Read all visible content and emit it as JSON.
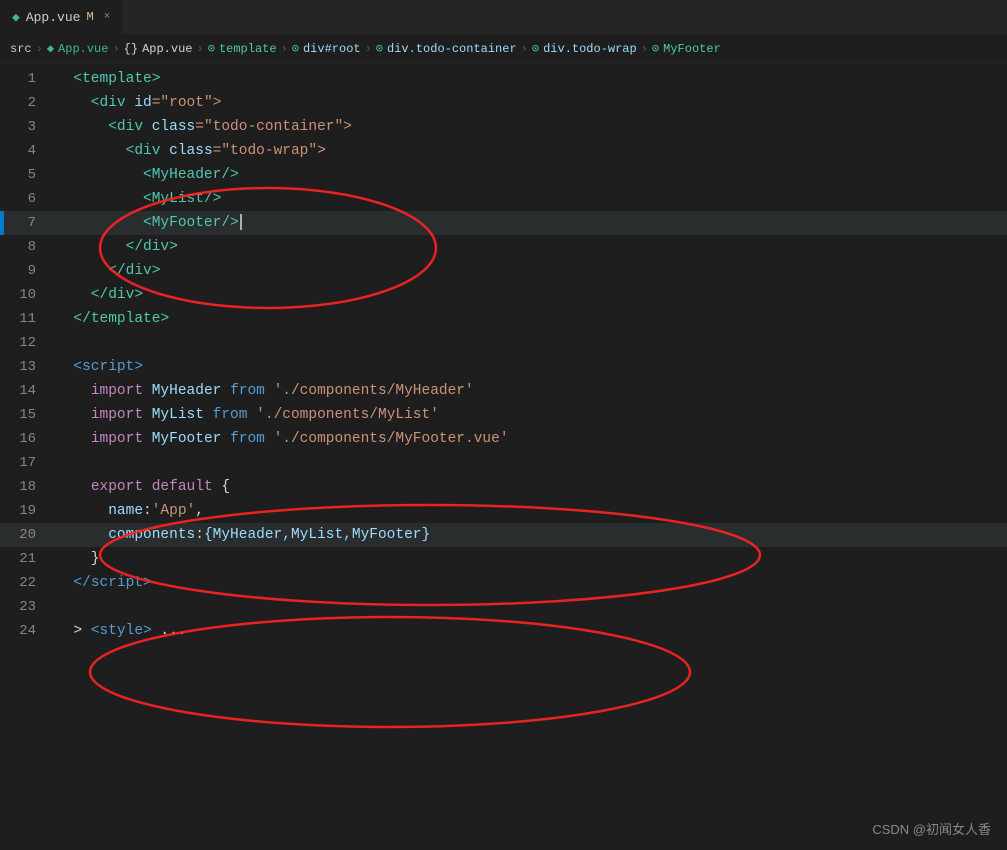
{
  "tab": {
    "filename": "App.vue",
    "modified": "M",
    "close_label": "×"
  },
  "breadcrumb": {
    "items": [
      "src",
      "App.vue",
      "App.vue",
      "template",
      "div#root",
      "div.todo-container",
      "div.todo-wrap",
      "MyFooter"
    ]
  },
  "lines": [
    {
      "num": 1,
      "tokens": [
        {
          "text": "  <",
          "cls": "c-tag"
        },
        {
          "text": "template",
          "cls": "c-tag"
        },
        {
          "text": ">",
          "cls": "c-tag"
        }
      ]
    },
    {
      "num": 2,
      "tokens": [
        {
          "text": "    <",
          "cls": "c-tag"
        },
        {
          "text": "div ",
          "cls": "c-tag"
        },
        {
          "text": "id",
          "cls": "c-attr-name"
        },
        {
          "text": "=\"root\">",
          "cls": "c-attr-val"
        }
      ]
    },
    {
      "num": 3,
      "tokens": [
        {
          "text": "      <",
          "cls": "c-tag"
        },
        {
          "text": "div ",
          "cls": "c-tag"
        },
        {
          "text": "class",
          "cls": "c-attr-name"
        },
        {
          "text": "=\"todo-container\">",
          "cls": "c-attr-val"
        }
      ]
    },
    {
      "num": 4,
      "tokens": [
        {
          "text": "        <",
          "cls": "c-tag"
        },
        {
          "text": "div ",
          "cls": "c-tag"
        },
        {
          "text": "class",
          "cls": "c-attr-name"
        },
        {
          "text": "=\"todo-wrap\">",
          "cls": "c-attr-val"
        }
      ]
    },
    {
      "num": 5,
      "tokens": [
        {
          "text": "          <",
          "cls": "c-component"
        },
        {
          "text": "MyHeader",
          "cls": "c-component"
        },
        {
          "text": "/>",
          "cls": "c-component"
        }
      ]
    },
    {
      "num": 6,
      "tokens": [
        {
          "text": "          <",
          "cls": "c-component"
        },
        {
          "text": "MyList",
          "cls": "c-component"
        },
        {
          "text": "/>",
          "cls": "c-component"
        }
      ]
    },
    {
      "num": 7,
      "tokens": [
        {
          "text": "          <",
          "cls": "c-component"
        },
        {
          "text": "MyFooter",
          "cls": "c-component"
        },
        {
          "text": "/>",
          "cls": "c-component"
        }
      ],
      "active": true
    },
    {
      "num": 8,
      "tokens": [
        {
          "text": "        </",
          "cls": "c-tag"
        },
        {
          "text": "div",
          "cls": "c-tag"
        },
        {
          "text": ">",
          "cls": "c-tag"
        }
      ]
    },
    {
      "num": 9,
      "tokens": [
        {
          "text": "      </",
          "cls": "c-tag"
        },
        {
          "text": "div",
          "cls": "c-tag"
        },
        {
          "text": ">",
          "cls": "c-tag"
        }
      ]
    },
    {
      "num": 10,
      "tokens": [
        {
          "text": "    </",
          "cls": "c-tag"
        },
        {
          "text": "div",
          "cls": "c-tag"
        },
        {
          "text": ">",
          "cls": "c-tag"
        }
      ]
    },
    {
      "num": 11,
      "tokens": [
        {
          "text": "  </",
          "cls": "c-tag"
        },
        {
          "text": "template",
          "cls": "c-tag"
        },
        {
          "text": ">",
          "cls": "c-tag"
        }
      ]
    },
    {
      "num": 12,
      "tokens": []
    },
    {
      "num": 13,
      "tokens": [
        {
          "text": "  <",
          "cls": "c-script"
        },
        {
          "text": "script",
          "cls": "c-script"
        },
        {
          "text": ">",
          "cls": "c-script"
        }
      ]
    },
    {
      "num": 14,
      "tokens": [
        {
          "text": "    ",
          "cls": ""
        },
        {
          "text": "import",
          "cls": "c-keyword"
        },
        {
          "text": " ",
          "cls": ""
        },
        {
          "text": "MyHeader",
          "cls": "c-import-name"
        },
        {
          "text": " ",
          "cls": ""
        },
        {
          "text": "from",
          "cls": "c-from"
        },
        {
          "text": " ",
          "cls": ""
        },
        {
          "text": "'./components/MyHeader'",
          "cls": "c-string"
        }
      ]
    },
    {
      "num": 15,
      "tokens": [
        {
          "text": "    ",
          "cls": ""
        },
        {
          "text": "import",
          "cls": "c-keyword"
        },
        {
          "text": " ",
          "cls": ""
        },
        {
          "text": "MyList",
          "cls": "c-import-name"
        },
        {
          "text": " ",
          "cls": ""
        },
        {
          "text": "from",
          "cls": "c-from"
        },
        {
          "text": " ",
          "cls": ""
        },
        {
          "text": "'./components/MyList'",
          "cls": "c-string"
        }
      ]
    },
    {
      "num": 16,
      "tokens": [
        {
          "text": "    ",
          "cls": ""
        },
        {
          "text": "import",
          "cls": "c-keyword"
        },
        {
          "text": " ",
          "cls": ""
        },
        {
          "text": "MyFooter",
          "cls": "c-import-name"
        },
        {
          "text": " ",
          "cls": ""
        },
        {
          "text": "from",
          "cls": "c-from"
        },
        {
          "text": " ",
          "cls": ""
        },
        {
          "text": "'./components/MyFooter.vue'",
          "cls": "c-string"
        }
      ]
    },
    {
      "num": 17,
      "tokens": []
    },
    {
      "num": 18,
      "tokens": [
        {
          "text": "    ",
          "cls": ""
        },
        {
          "text": "export",
          "cls": "c-keyword"
        },
        {
          "text": " ",
          "cls": ""
        },
        {
          "text": "default",
          "cls": "c-keyword"
        },
        {
          "text": " {",
          "cls": "c-plain"
        }
      ]
    },
    {
      "num": 19,
      "tokens": [
        {
          "text": "      ",
          "cls": ""
        },
        {
          "text": "name",
          "cls": "c-prop"
        },
        {
          "text": ":",
          "cls": "c-plain"
        },
        {
          "text": "'App'",
          "cls": "c-string"
        },
        {
          "text": ",",
          "cls": "c-plain"
        }
      ]
    },
    {
      "num": 20,
      "tokens": [
        {
          "text": "      ",
          "cls": ""
        },
        {
          "text": "components",
          "cls": "c-prop"
        },
        {
          "text": ":",
          "cls": "c-plain"
        },
        {
          "text": "{MyHeader,MyList,MyFooter}",
          "cls": "c-import-name"
        }
      ],
      "active2": true
    },
    {
      "num": 21,
      "tokens": [
        {
          "text": "    }",
          "cls": "c-plain"
        }
      ]
    },
    {
      "num": 22,
      "tokens": [
        {
          "text": "  </",
          "cls": "c-script"
        },
        {
          "text": "script",
          "cls": "c-script"
        },
        {
          "text": ">",
          "cls": "c-script"
        }
      ]
    },
    {
      "num": 23,
      "tokens": []
    },
    {
      "num": 24,
      "tokens": [
        {
          "text": "  > ",
          "cls": "c-plain"
        },
        {
          "text": "<",
          "cls": "c-script"
        },
        {
          "text": "style",
          "cls": "c-script"
        },
        {
          "text": ">",
          "cls": "c-script"
        },
        {
          "text": " ...",
          "cls": "c-plain"
        }
      ]
    }
  ],
  "watermark": "CSDN @初闻女人香"
}
